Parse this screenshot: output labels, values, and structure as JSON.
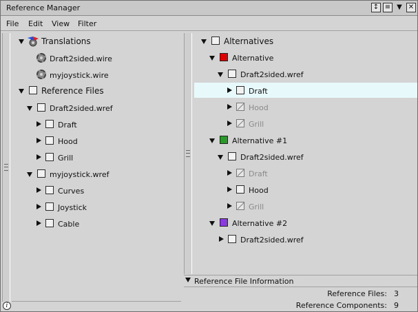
{
  "window": {
    "title": "Reference Manager",
    "buttons": [
      "expand-icon",
      "list-icon",
      "chevron-down-icon",
      "close-icon"
    ]
  },
  "menu": {
    "file": "File",
    "edit": "Edit",
    "view": "View",
    "filter": "Filter"
  },
  "left_tree": {
    "translations": "Translations",
    "translation_files": [
      "Draft2sided.wire",
      "myjoystick.wire"
    ],
    "reference_files": "Reference Files",
    "file1": {
      "name": "Draft2sided.wref",
      "children": [
        "Draft",
        "Hood",
        "Grill"
      ]
    },
    "file2": {
      "name": "myjoystick.wref",
      "children": [
        "Curves",
        "Joystick",
        "Cable"
      ]
    }
  },
  "right_tree": {
    "alternatives": "Alternatives",
    "alt1": {
      "name": "Alternative",
      "color": "#e00000",
      "file": "Draft2sided.wref",
      "children": [
        "Draft",
        "Hood",
        "Grill"
      ]
    },
    "alt2": {
      "name": "Alternative #1",
      "color": "#2a9a2a",
      "file": "Draft2sided.wref",
      "children": [
        "Draft",
        "Hood",
        "Grill"
      ]
    },
    "alt3": {
      "name": "Alternative #2",
      "color": "#8a3ae0",
      "file": "Draft2sided.wref"
    }
  },
  "info": {
    "header": "Reference File Information",
    "ref_files_label": "Reference Files:",
    "ref_files_value": "3",
    "ref_components_label": "Reference Components:",
    "ref_components_value": "9"
  }
}
